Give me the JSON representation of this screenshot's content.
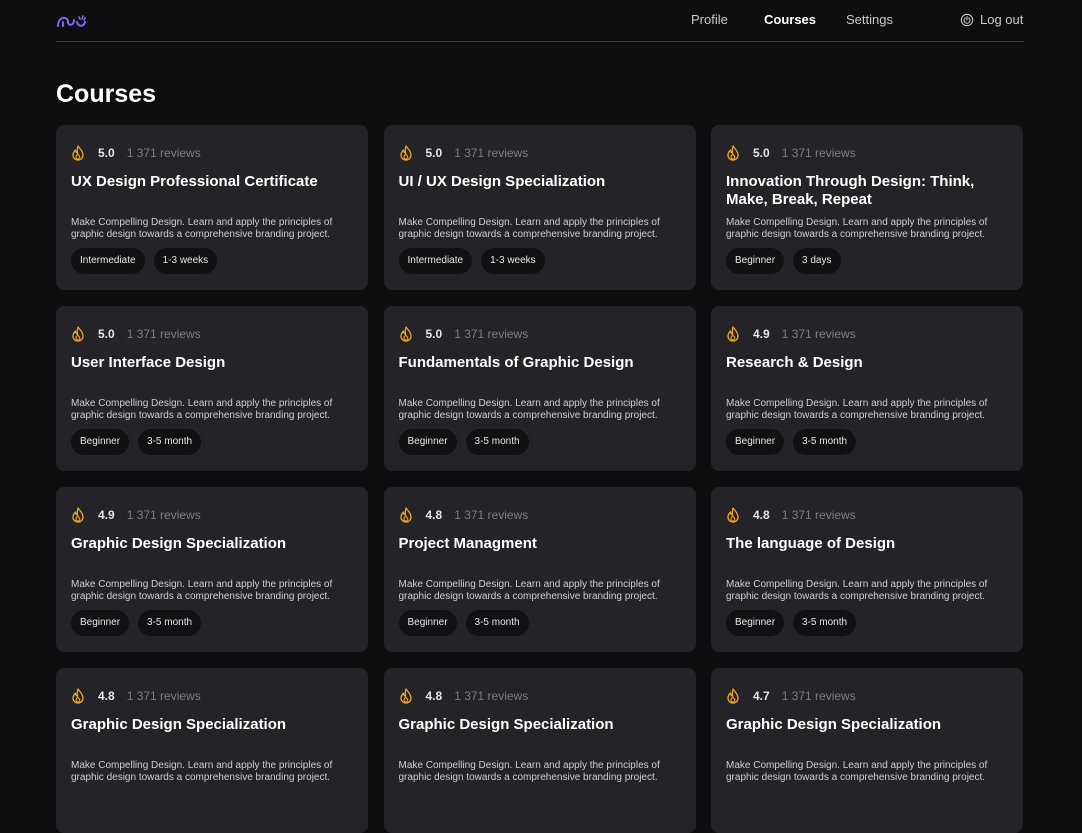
{
  "nav": {
    "items": [
      "Profile",
      "Courses",
      "Settings"
    ],
    "active": "Courses",
    "logout_label": "Log out"
  },
  "page": {
    "title": "Courses"
  },
  "colors": {
    "background": "#0e0e10",
    "card": "#242428",
    "accent": "#f5a623",
    "logo": "#7b6cf6"
  },
  "courses": [
    {
      "rating": "5.0",
      "reviews": "1 371 reviews",
      "title": "UX Design Professional Certificate",
      "description": "Make Compelling Design. Learn and apply the principles of graphic design towards a comprehensive branding project.",
      "level": "Intermediate",
      "duration": "1-3 weeks"
    },
    {
      "rating": "5.0",
      "reviews": "1 371 reviews",
      "title": "UI / UX Design Specialization",
      "description": "Make Compelling Design. Learn and apply the principles of graphic design towards a comprehensive branding project.",
      "level": "Intermediate",
      "duration": "1-3 weeks"
    },
    {
      "rating": "5.0",
      "reviews": "1 371 reviews",
      "title": "Innovation Through Design: Think, Make, Break, Repeat",
      "description": "Make Compelling Design. Learn and apply the principles of graphic design towards a comprehensive branding project.",
      "level": "Beginner",
      "duration": "3 days"
    },
    {
      "rating": "5.0",
      "reviews": "1 371 reviews",
      "title": "User Interface Design",
      "description": "Make Compelling Design. Learn and apply the principles of graphic design towards a comprehensive branding project.",
      "level": "Beginner",
      "duration": "3-5 month"
    },
    {
      "rating": "5.0",
      "reviews": "1 371 reviews",
      "title": "Fundamentals of Graphic Design",
      "description": "Make Compelling Design. Learn and apply the principles of graphic design towards a comprehensive branding project.",
      "level": "Beginner",
      "duration": "3-5 month"
    },
    {
      "rating": "4.9",
      "reviews": "1 371 reviews",
      "title": "Research & Design",
      "description": "Make Compelling Design. Learn and apply the principles of graphic design towards a comprehensive branding project.",
      "level": "Beginner",
      "duration": "3-5 month"
    },
    {
      "rating": "4.9",
      "reviews": "1 371 reviews",
      "title": "Graphic Design Specialization",
      "description": "Make Compelling Design. Learn and apply the principles of graphic design towards a comprehensive branding project.",
      "level": "Beginner",
      "duration": "3-5 month"
    },
    {
      "rating": "4.8",
      "reviews": "1 371 reviews",
      "title": "Project Managment",
      "description": "Make Compelling Design. Learn and apply the principles of graphic design towards a comprehensive branding project.",
      "level": "Beginner",
      "duration": "3-5 month"
    },
    {
      "rating": "4.8",
      "reviews": "1 371 reviews",
      "title": "The language of Design",
      "description": "Make Compelling Design. Learn and apply the principles of graphic design towards a comprehensive branding project.",
      "level": "Beginner",
      "duration": "3-5 month"
    },
    {
      "rating": "4.8",
      "reviews": "1 371 reviews",
      "title": "Graphic Design Specialization",
      "description": "Make Compelling Design. Learn and apply the principles of graphic design towards a comprehensive branding project.",
      "level": "",
      "duration": ""
    },
    {
      "rating": "4.8",
      "reviews": "1 371 reviews",
      "title": "Graphic Design Specialization",
      "description": "Make Compelling Design. Learn and apply the principles of graphic design towards a comprehensive branding project.",
      "level": "",
      "duration": ""
    },
    {
      "rating": "4.7",
      "reviews": "1 371 reviews",
      "title": "Graphic Design Specialization",
      "description": "Make Compelling Design. Learn and apply the principles of graphic design towards a comprehensive branding project.",
      "level": "",
      "duration": ""
    }
  ]
}
